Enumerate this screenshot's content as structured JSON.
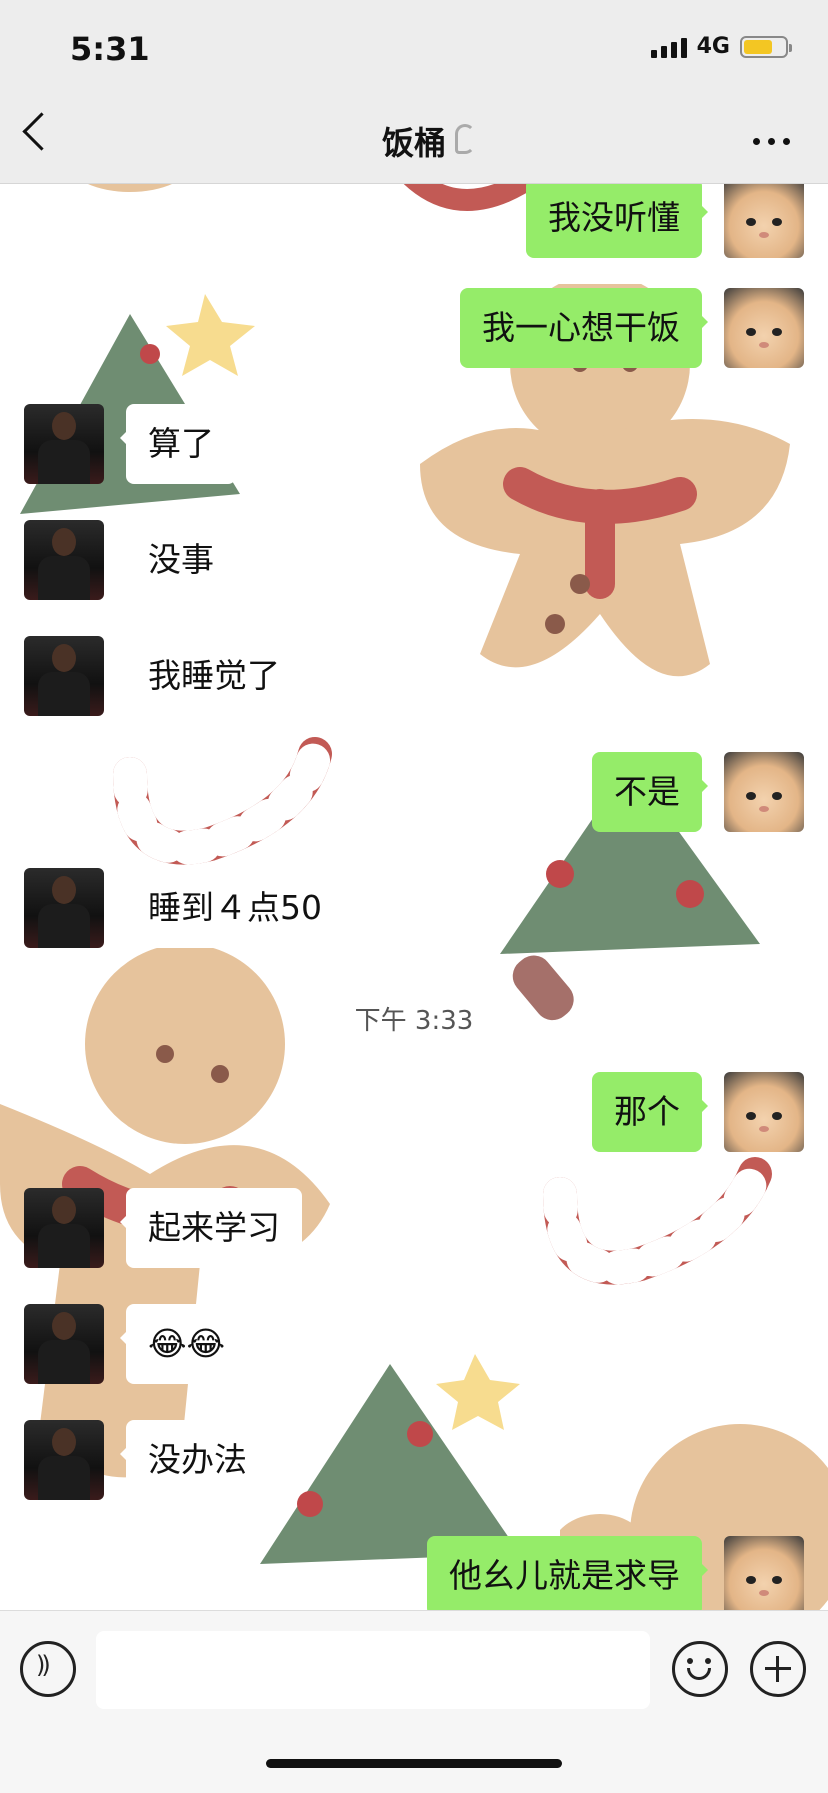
{
  "status_bar": {
    "time": "5:31",
    "network": "4G",
    "battery_color": "#f3c623"
  },
  "nav": {
    "title": "饭桶"
  },
  "messages": [
    {
      "side": "right",
      "text": "我没听懂"
    },
    {
      "side": "right",
      "text": "我一心想干饭"
    },
    {
      "side": "left",
      "text": "算了"
    },
    {
      "side": "left",
      "text": "没事"
    },
    {
      "side": "left",
      "text": "我睡觉了"
    },
    {
      "side": "right",
      "text": "不是"
    },
    {
      "side": "left",
      "text": "睡到４点50"
    },
    {
      "side": "right",
      "text": "那个"
    },
    {
      "side": "left",
      "text": "起来学习"
    },
    {
      "side": "left",
      "text": "😂😂"
    },
    {
      "side": "left",
      "text": "没办法"
    },
    {
      "side": "right",
      "text": "他幺儿就是求导"
    }
  ],
  "timestamp": "下午 3:33",
  "colors": {
    "sent_bubble": "#95ec69",
    "received_bubble": "#ffffff",
    "bar_bg": "#ededed"
  }
}
